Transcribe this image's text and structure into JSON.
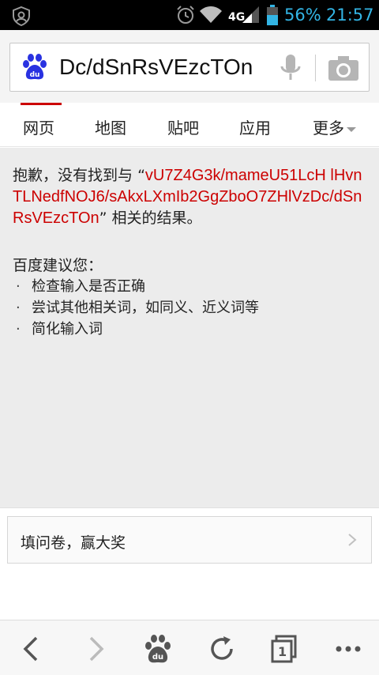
{
  "status_bar": {
    "network": "4G",
    "battery": "56%",
    "time": "21:57"
  },
  "search": {
    "query": "Dc/dSnRsVEzcTOn"
  },
  "tabs": [
    {
      "label": "网页"
    },
    {
      "label": "地图"
    },
    {
      "label": "贴吧"
    },
    {
      "label": "应用"
    },
    {
      "label": "更多"
    }
  ],
  "result": {
    "prefix": "抱歉，没有找到与",
    "open_quote": "“",
    "query": "vU7Z4G3k/mameU51LcH lHvnTLNedfNOJ6/sAkxLXmIb2GgZboO7ZHlVzDc/dSnRsVEzcTOn",
    "close_quote": "”",
    "suffix": " 相关的结果。"
  },
  "suggestions": {
    "title": "百度建议您：",
    "bullet": "·",
    "items": [
      "检查输入是否正确",
      "尝试其他相关词，如同义、近义词等",
      "简化输入词"
    ]
  },
  "survey": {
    "label": "填问卷，赢大奖"
  },
  "toolbar": {
    "tab_count": "1"
  },
  "colors": {
    "accent_red": "#cc0000",
    "baidu_blue": "#2932e1",
    "status_blue": "#33b5e5"
  }
}
